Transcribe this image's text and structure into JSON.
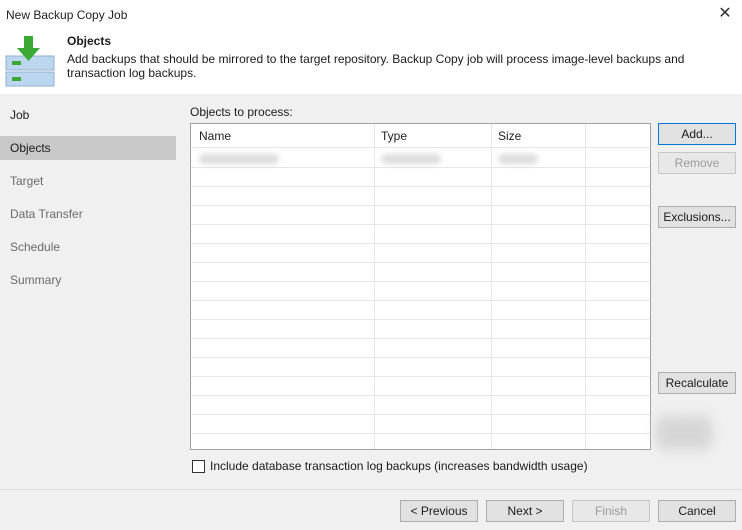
{
  "window": {
    "title": "New Backup Copy Job",
    "close_glyph": "✕"
  },
  "header": {
    "title": "Objects",
    "description": "Add backups that should be mirrored to the target repository. Backup Copy job will process image-level backups and transaction log backups.",
    "icon": "backup-copy-icon",
    "colors": {
      "arrow": "#3aaa35",
      "card": "#bcd6ef"
    }
  },
  "sidebar": {
    "items": [
      {
        "label": "Job",
        "state": "done"
      },
      {
        "label": "Objects",
        "state": "active"
      },
      {
        "label": "Target",
        "state": "pending"
      },
      {
        "label": "Data Transfer",
        "state": "pending"
      },
      {
        "label": "Schedule",
        "state": "pending"
      },
      {
        "label": "Summary",
        "state": "pending"
      }
    ]
  },
  "objects": {
    "label": "Objects to process:",
    "columns": [
      "Name",
      "Type",
      "Size"
    ]
  },
  "side_buttons": {
    "add": "Add...",
    "remove": "Remove",
    "exclusions": "Exclusions...",
    "recalculate": "Recalculate"
  },
  "options": {
    "include_logs_label": "Include database transaction log backups (increases bandwidth usage)",
    "include_logs_checked": false
  },
  "footer": {
    "previous": "< Previous",
    "next": "Next >",
    "finish": "Finish",
    "cancel": "Cancel"
  }
}
